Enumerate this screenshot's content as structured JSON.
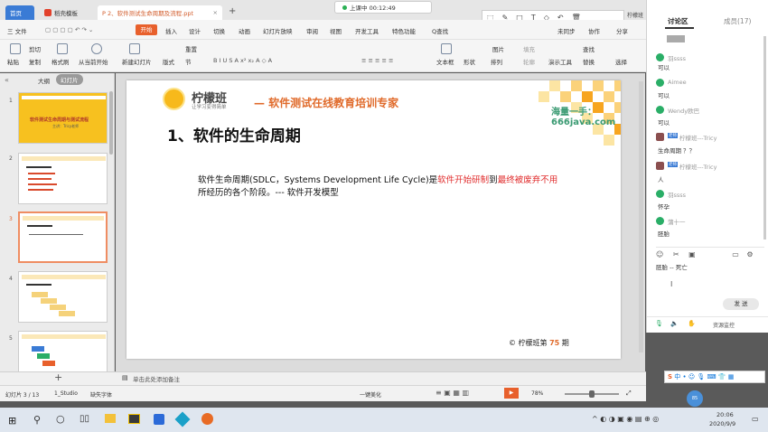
{
  "tabs": {
    "home": "首页",
    "templates": "稻壳模板",
    "doc": "P 2、软件测试生命周期及流程.ppt"
  },
  "live": {
    "status": "上课中 00:12:49",
    "user": "柠檬班"
  },
  "menu": {
    "file": "三 文件",
    "start": "开始",
    "items": [
      "插入",
      "设计",
      "切换",
      "动画",
      "幻灯片放映",
      "审阅",
      "视图",
      "开发工具",
      "特色功能"
    ],
    "search": "Q查找",
    "sync": "未同步",
    "collab": "协作",
    "share": "分享"
  },
  "ribbon": {
    "paste": "粘贴",
    "cut": "剪切",
    "copy": "复制",
    "format_painter": "格式刷",
    "from_current": "从当前开始",
    "new_slide": "新建幻灯片",
    "layout": "版式",
    "section": "节",
    "reset": "重置",
    "textbox": "文本框",
    "shape": "形状",
    "arrange": "排列",
    "image": "图片",
    "fill": "填充",
    "outline": "轮廓",
    "present": "演示工具",
    "find": "查找",
    "replace": "替换",
    "select": "选择"
  },
  "leftpane": {
    "outline": "大纲",
    "slides": "幻灯片",
    "nums": [
      "1",
      "2",
      "3",
      "4",
      "5"
    ],
    "thumb1_title": "软件测试生命周期与测试流程",
    "thumb1_sub": "主讲：Tricy老师"
  },
  "slide": {
    "logo_text": "柠檬班",
    "logo_sub": "让学习变得简单",
    "slogan": "— 软件测试在线教育培训专家",
    "watermark": "海量一手：666java.com",
    "heading": "1、软件的生命周期",
    "body_prefix": "软件生命周期(SDLC，Systems Development Life Cycle)是",
    "body_red1": "软件开始研制",
    "body_mid": "到",
    "body_red2": "最终被废弃不用",
    "body_line2": "所经历的各个阶段。--- 软件开发模型",
    "footer_prefix": "© 柠檬班第",
    "footer_num": "75",
    "footer_suffix": "期"
  },
  "notes": "单击此处添加备注",
  "status": {
    "slide_count": "幻灯片 3 / 13",
    "theme": "1_Studio",
    "font": "缺失字体",
    "beautify": "一键美化",
    "zoom": "78%"
  },
  "chat": {
    "tab_chat": "讨论区",
    "tab_members": "成员(17)",
    "messages": [
      {
        "name": "",
        "text": "可以",
        "color": "#2aae67"
      },
      {
        "name": "羽ssss",
        "text": "可以",
        "color": "#2aae67"
      },
      {
        "name": "Aimee",
        "text": "可以",
        "color": "#2aae67"
      },
      {
        "name": "Wendy欧巴",
        "text": "可以",
        "color": "#2aae67"
      },
      {
        "name": "柠檬班---Tricy",
        "text": "生命周期 ？？",
        "color": "#8b4f4f",
        "badge": "老师"
      },
      {
        "name": "柠檬班---Tricy",
        "text": "人",
        "color": "#8b4f4f",
        "badge": "老师"
      },
      {
        "name": "羽ssss",
        "text": "怀孕",
        "color": "#2aae67"
      },
      {
        "name": "蒲十一",
        "text": "胚胎",
        "color": "#2aae67"
      }
    ],
    "input_text": "胚胎 -- 死亡",
    "send": "发 送",
    "resource": "资源监控"
  },
  "taskbar": {
    "time": "20:06",
    "date": "2020/9/9"
  }
}
